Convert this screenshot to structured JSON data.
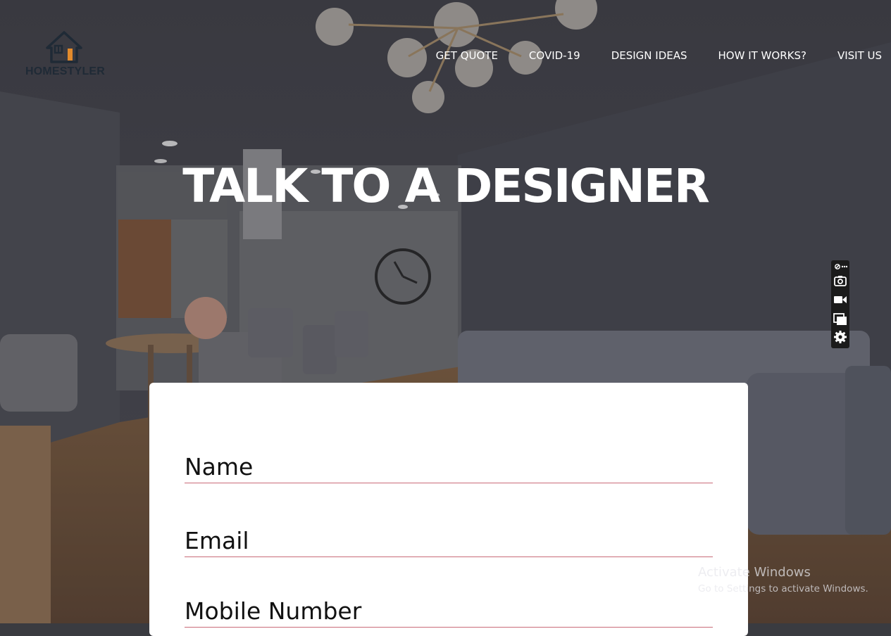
{
  "header": {
    "logo_text": "HOMESTYLER",
    "nav": [
      {
        "label": "GET QUOTE"
      },
      {
        "label": "COVID-19"
      },
      {
        "label": "DESIGN IDEAS"
      },
      {
        "label": "HOW IT WORKS?"
      },
      {
        "label": "VISIT US"
      }
    ]
  },
  "hero": {
    "title": "TALK TO A DESIGNER"
  },
  "form": {
    "name_placeholder": "Name",
    "email_placeholder": "Email",
    "mobile_placeholder": "Mobile Number"
  },
  "toolbar": {
    "icons": [
      "link-icon",
      "more-icon",
      "camera-icon",
      "video-icon",
      "window-icon",
      "settings-icon"
    ]
  },
  "watermark": {
    "title": "Activate Windows",
    "subtitle": "Go to Settings to activate Windows."
  },
  "colors": {
    "field_underline": "#c96a78",
    "logo_accent": "#e38b2c",
    "logo_dark": "#1f2a36"
  }
}
